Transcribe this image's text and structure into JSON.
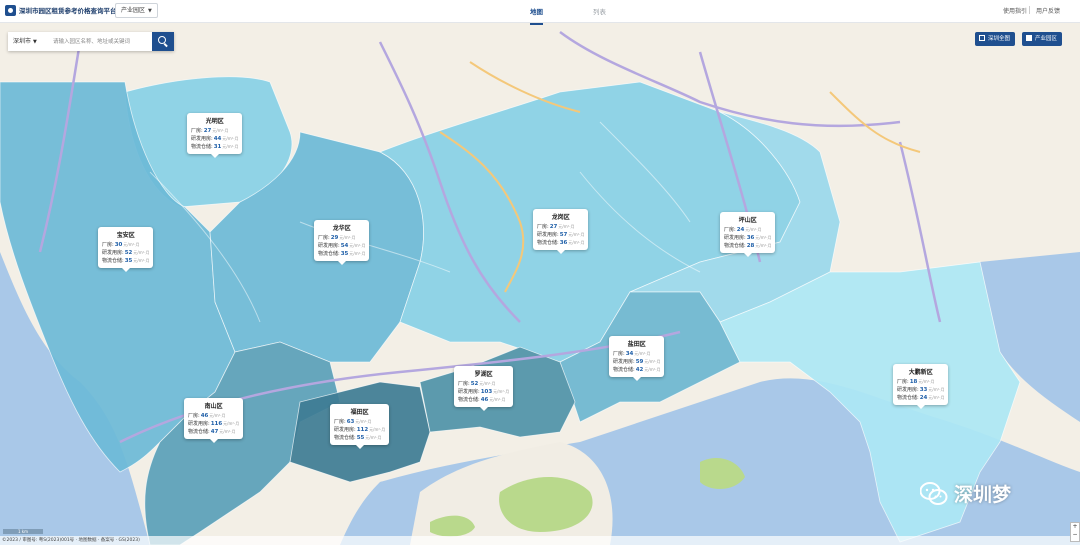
{
  "header": {
    "title": "深圳市园区租赁参考价格查询平台",
    "park_select": "产业园区",
    "tabs": [
      {
        "label": "地图",
        "active": true
      },
      {
        "label": "列表",
        "active": false
      }
    ],
    "guide_link": "使用指引",
    "feedback_link": "用户反馈"
  },
  "search": {
    "city": "深圳市",
    "placeholder": "请输入园区名称、地址或关键词"
  },
  "map_buttons": {
    "full_map": "深圳全图",
    "industry_park": "产业园区"
  },
  "row_labels": {
    "factory": "厂房:",
    "rd": "研发用房:",
    "warehouse": "物流仓储:"
  },
  "unit": "元/m²·月",
  "districts": [
    {
      "name": "光明区",
      "factory": "27",
      "rd": "44",
      "warehouse": "31",
      "fill": "#88d0e6"
    },
    {
      "name": "宝安区",
      "factory": "30",
      "rd": "52",
      "warehouse": "35",
      "fill": "#6cbad7"
    },
    {
      "name": "龙华区",
      "factory": "29",
      "rd": "54",
      "warehouse": "35",
      "fill": "#6cbad7"
    },
    {
      "name": "龙岗区",
      "factory": "27",
      "rd": "57",
      "warehouse": "36",
      "fill": "#88d0e6"
    },
    {
      "name": "坪山区",
      "factory": "24",
      "rd": "36",
      "warehouse": "28",
      "fill": "#9ad8ec"
    },
    {
      "name": "盐田区",
      "factory": "34",
      "rd": "59",
      "warehouse": "42",
      "fill": "#6cb6d0"
    },
    {
      "name": "大鹏新区",
      "factory": "18",
      "rd": "33",
      "warehouse": "24",
      "fill": "#ace7f4"
    },
    {
      "name": "南山区",
      "factory": "46",
      "rd": "116",
      "warehouse": "47",
      "fill": "#5aa0b8"
    },
    {
      "name": "福田区",
      "factory": "63",
      "rd": "112",
      "warehouse": "55",
      "fill": "#3e7c94"
    },
    {
      "name": "罗湖区",
      "factory": "52",
      "rd": "103",
      "warehouse": "46",
      "fill": "#4f93a8"
    }
  ],
  "watermark": "深圳梦",
  "copyright": "©2023 / 审图号: 粤S(2023)001号 · 地图数据 · 备案号 · GS(2023)",
  "scale": "1 km"
}
